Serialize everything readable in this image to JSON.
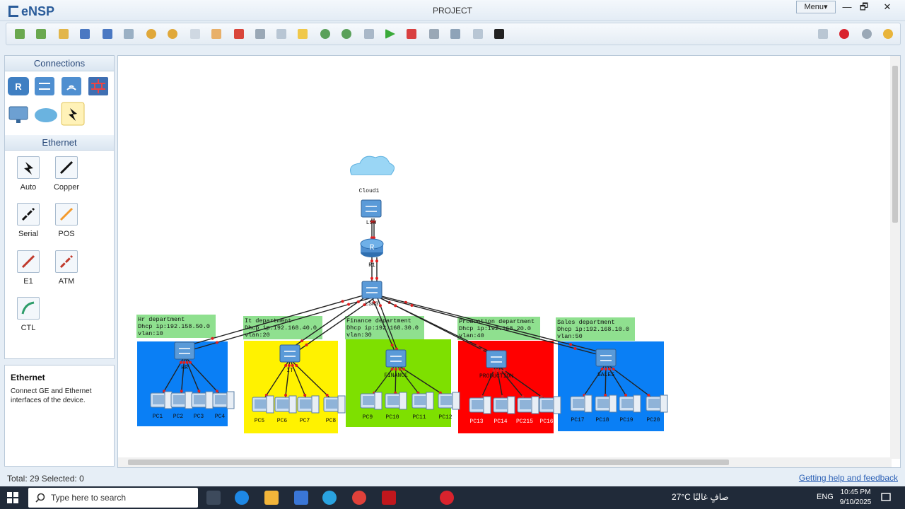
{
  "app": {
    "logo": "eNSP",
    "title": "PROJECT",
    "menu_label": "Menu▾"
  },
  "window_controls": {
    "minimize": "—",
    "restore": "🗗",
    "close": "✕"
  },
  "palette": {
    "connections_header": "Connections",
    "ethernet_header": "Ethernet",
    "cables": [
      {
        "label": "Auto",
        "color": "#111111"
      },
      {
        "label": "Copper",
        "color": "#111111"
      },
      {
        "label": "Serial",
        "color": "#111111"
      },
      {
        "label": "POS",
        "color": "#f39a2c"
      },
      {
        "label": "E1",
        "color": "#c0392b"
      },
      {
        "label": "ATM",
        "color": "#c0392b"
      },
      {
        "label": "CTL",
        "color": "#2e9d6a"
      }
    ]
  },
  "info": {
    "title": "Ethernet",
    "description": "Connect GE and Ethernet interfaces of the device."
  },
  "topology": {
    "core_nodes": [
      {
        "label": "Cloud1",
        "type": "cloud"
      },
      {
        "label": "LSW",
        "type": "switch"
      },
      {
        "label": "R1",
        "type": "router"
      },
      {
        "label": "LSW3",
        "type": "switch"
      }
    ],
    "departments": [
      {
        "note": [
          "Hr department",
          "Dhcp ip:192.158.50.0",
          "vlan:10"
        ],
        "switch_label": "HR",
        "color": "#0a7ff5",
        "pcs": [
          "PC1",
          "PC2",
          "PC3",
          "PC4"
        ]
      },
      {
        "note": [
          "It department",
          "Dhcp ip:192.168.40.0",
          "vlan:20"
        ],
        "switch_label": "IT",
        "color": "#fff200",
        "pcs": [
          "PC5",
          "PC6",
          "PC7",
          "PC8"
        ]
      },
      {
        "note": [
          "Finance department",
          "Dhcp ip:192.168.30.0",
          "vlan:30"
        ],
        "switch_label": "FINANCE",
        "color": "#7ee000",
        "pcs": [
          "PC9",
          "PC10",
          "PC11",
          "PC12"
        ]
      },
      {
        "note": [
          "Production department",
          "Dhcp ip:192.168.20.0",
          "vlan:40"
        ],
        "switch_label": "PRODUCTION",
        "color": "#ff0000",
        "pcs": [
          "PC13",
          "PC14",
          "PC215",
          "PC16"
        ]
      },
      {
        "note": [
          "Sales department",
          "Dhcp ip:192.168.10.0",
          "vlan:50"
        ],
        "switch_label": "SALES",
        "color": "#0a7ff5",
        "pcs": [
          "PC17",
          "PC18",
          "PC19",
          "PC20"
        ]
      }
    ],
    "note_color": "#8fe08f"
  },
  "status": {
    "left": "Total: 29  Selected: 0",
    "help": "Getting help and feedback"
  },
  "taskbar": {
    "search_placeholder": "Type here to search",
    "weather": "27°C  صافٍ غالبًا",
    "lang": "ENG",
    "time": "10:45 PM",
    "date": "9/10/2025"
  }
}
